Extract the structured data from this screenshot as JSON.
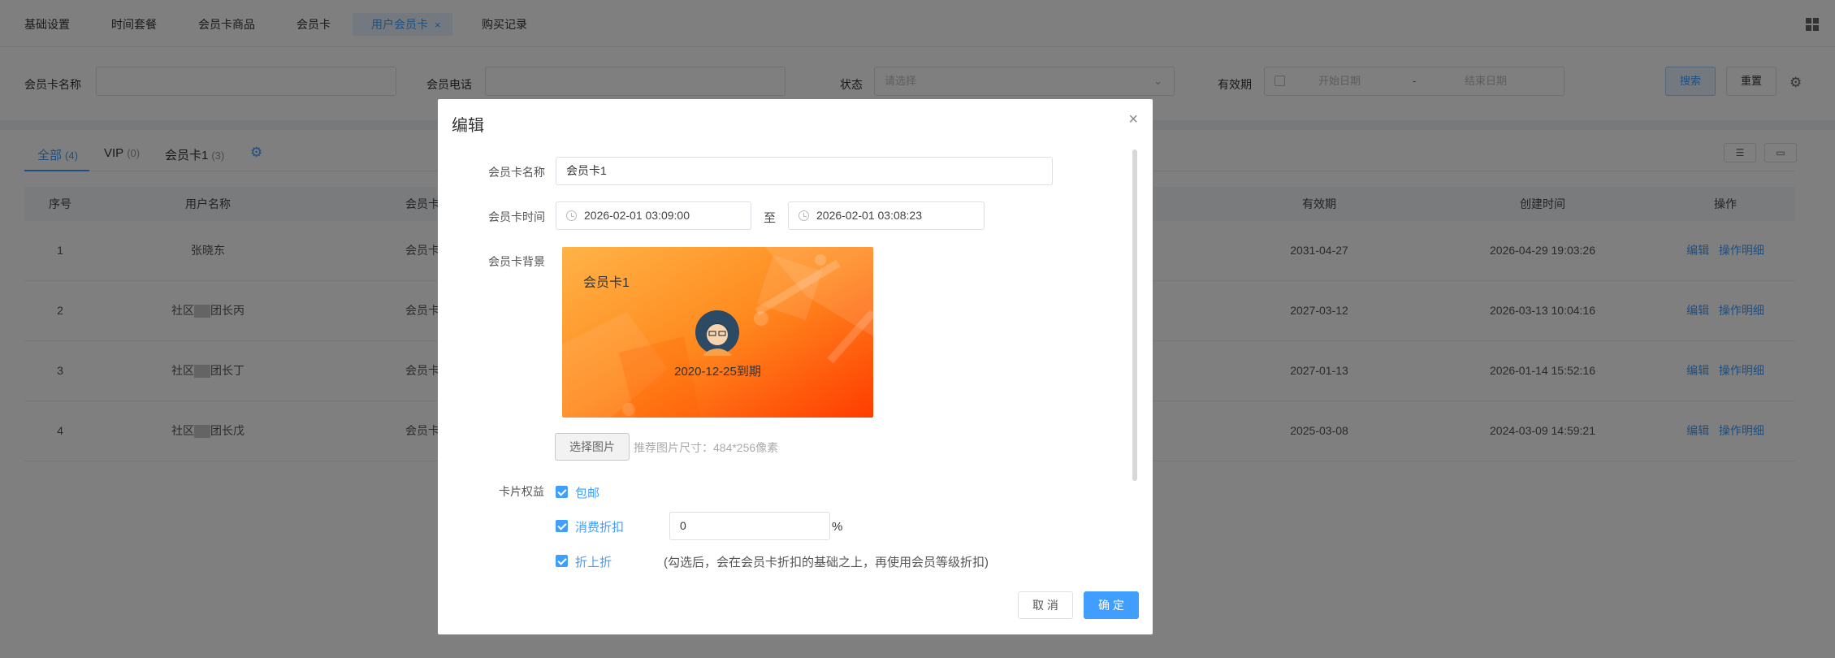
{
  "tabs": [
    {
      "label": "基础设置"
    },
    {
      "label": "时间套餐"
    },
    {
      "label": "会员卡商品"
    },
    {
      "label": "会员卡"
    },
    {
      "label": "用户会员卡",
      "close": "×"
    },
    {
      "label": "购买记录"
    }
  ],
  "filter": {
    "card_name_label": "会员卡名称",
    "phone_label": "会员电话",
    "status_label": "状态",
    "status_placeholder": "请选择",
    "validity_label": "有效期",
    "start_placeholder": "开始日期",
    "range_sep": "-",
    "end_placeholder": "结束日期",
    "search": "搜索",
    "reset": "重置"
  },
  "subtabs": [
    {
      "label": "全部",
      "count": "(4)"
    },
    {
      "label": "VIP",
      "count": "(0)"
    },
    {
      "label": "会员卡1",
      "count": "(3)"
    }
  ],
  "table": {
    "headers": [
      "序号",
      "用户名称",
      "会员卡",
      "有效期",
      "创建时间",
      "操作"
    ],
    "rows": [
      {
        "no": "1",
        "name_a": "张晓东",
        "name_b": "",
        "card": "会员卡",
        "valid": "2031-04-27",
        "created": "2026-04-29 19:03:26"
      },
      {
        "no": "2",
        "name_a": "社区",
        "name_b": "团长丙",
        "card": "会员卡",
        "valid": "2027-03-12",
        "created": "2026-03-13 10:04:16"
      },
      {
        "no": "3",
        "name_a": "社区",
        "name_b": "团长丁",
        "card": "会员卡",
        "valid": "2027-01-13",
        "created": "2026-01-14 15:52:16"
      },
      {
        "no": "4",
        "name_a": "社区",
        "name_b": "团长戊",
        "card": "会员卡",
        "valid": "2025-03-08",
        "created": "2024-03-09 14:59:21"
      }
    ],
    "edit": "编辑",
    "detail": "操作明细"
  },
  "modal": {
    "title": "编辑",
    "close": "×",
    "name_label": "会员卡名称",
    "name_value": "会员卡1",
    "time_label": "会员卡时间",
    "start_time": "2026-02-01 03:09:00",
    "to": "至",
    "end_time": "2026-02-01 03:08:23",
    "bg_label": "会员卡背景",
    "card_title": "会员卡1",
    "card_expire": "2020-12-25到期",
    "choose_image": "选择图片",
    "hint": "推荐图片尺寸：484*256像素",
    "rights_label": "卡片权益",
    "right_shipping": "包邮",
    "right_discount": "消费折扣",
    "discount_value": "0",
    "percent": "%",
    "right_stack": "折上折",
    "stack_note": "(勾选后，会在会员卡折扣的基础之上，再使用会员等级折扣)",
    "cancel": "取 消",
    "confirm": "确 定"
  },
  "colors": {
    "primary": "#409eff",
    "card_orange_light": "#ffa63f",
    "card_orange_dark": "#ff4500"
  }
}
